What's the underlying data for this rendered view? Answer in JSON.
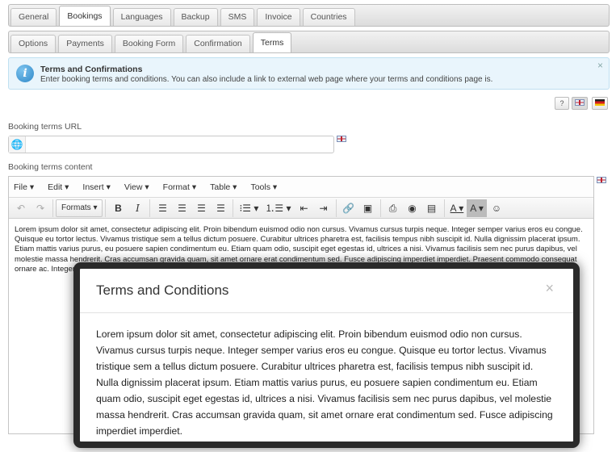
{
  "tabs": {
    "top": [
      "General",
      "Bookings",
      "Languages",
      "Backup",
      "SMS",
      "Invoice",
      "Countries"
    ],
    "top_active": 1,
    "sub": [
      "Options",
      "Payments",
      "Booking Form",
      "Confirmation",
      "Terms"
    ],
    "sub_active": 4
  },
  "info": {
    "title": "Terms and Confirmations",
    "desc": "Enter booking terms and conditions. You can also include a link to external web page where your terms and conditions page is.",
    "close": "×"
  },
  "lang": {
    "help": "?",
    "active": "en",
    "icons": [
      "help-icon",
      "flag-uk-icon",
      "flag-de-icon"
    ]
  },
  "url": {
    "label": "Booking terms URL",
    "value": ""
  },
  "content_label": "Booking terms content",
  "editor": {
    "menus": [
      "File",
      "Edit",
      "Insert",
      "View",
      "Format",
      "Table",
      "Tools"
    ],
    "formats": "Formats",
    "text": "Lorem ipsum dolor sit amet, consectetur adipiscing elit. Proin bibendum euismod odio non cursus. Vivamus cursus turpis neque. Integer semper varius eros eu congue. Quisque eu tortor lectus. Vivamus tristique sem a tellus dictum posuere. Curabitur ultrices pharetra est, facilisis tempus nibh suscipit id. Nulla dignissim placerat ipsum. Etiam mattis varius purus, eu posuere sapien condimentum eu. Etiam quam odio, suscipit eget egestas id, ultrices a nisi. Vivamus facilisis sem nec purus dapibus, vel molestie massa hendrerit. Cras accumsan gravida quam, sit amet ornare erat condimentum sed. Fusce adipiscing imperdiet imperdiet. Praesent commodo consequat ornare ac. Integer amet velit ac, viv Curabitur lacinia et condimentum nunc id, venenat lobortis quam, et odio non lectus."
  },
  "dialog": {
    "title": "Terms and Conditions",
    "close": "×",
    "text": "Lorem ipsum dolor sit amet, consectetur adipiscing elit. Proin bibendum euismod odio non cursus. Vivamus cursus turpis neque. Integer semper varius eros eu congue. Quisque eu tortor lectus. Vivamus tristique sem a tellus dictum posuere. Curabitur ultrices pharetra est, facilisis tempus nibh suscipit id. Nulla dignissim placerat ipsum. Etiam mattis varius purus, eu posuere sapien condimentum eu. Etiam quam odio, suscipit eget egestas id, ultrices a nisi. Vivamus facilisis sem nec purus dapibus, vel molestie massa hendrerit. Cras accumsan gravida quam, sit amet ornare erat condimentum sed. Fusce adipiscing imperdiet imperdiet."
  },
  "colors": {
    "accent": "#2f88c8",
    "info_bg": "#e9f5fc",
    "dialog_border": "#2a2a2a"
  }
}
